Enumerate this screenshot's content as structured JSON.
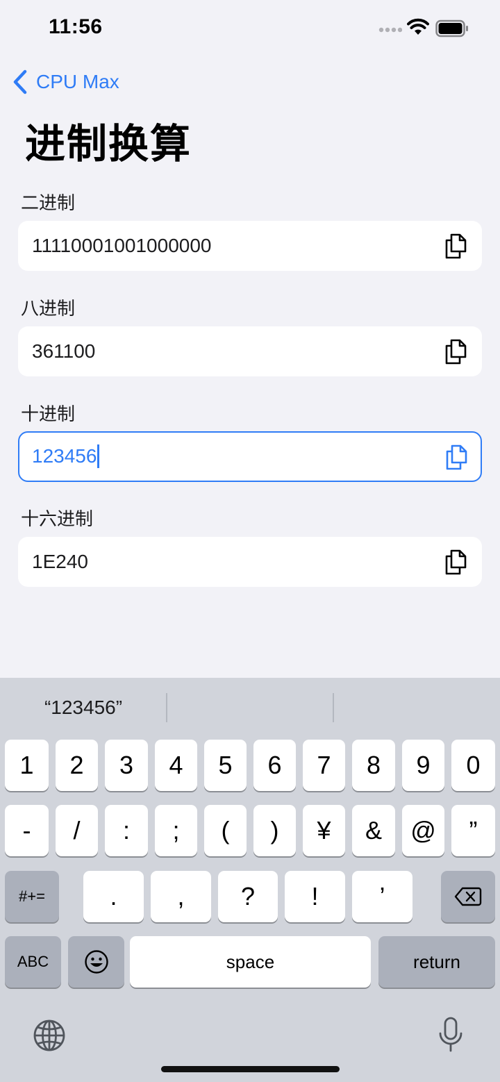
{
  "status_bar": {
    "time": "11:56"
  },
  "nav": {
    "back_label": "CPU Max",
    "title": "进制换算"
  },
  "fields": [
    {
      "label": "二进制",
      "value": "11110001001000000",
      "active": false
    },
    {
      "label": "八进制",
      "value": "361100",
      "active": false
    },
    {
      "label": "十进制",
      "value": "123456",
      "active": true
    },
    {
      "label": "十六进制",
      "value": "1E240",
      "active": false
    }
  ],
  "keyboard": {
    "suggestions": [
      "“123456”",
      "",
      ""
    ],
    "row1": [
      "1",
      "2",
      "3",
      "4",
      "5",
      "6",
      "7",
      "8",
      "9",
      "0"
    ],
    "row2": [
      "-",
      "/",
      ":",
      ";",
      "(",
      ")",
      "¥",
      "&",
      "@",
      "”"
    ],
    "row3_left": "#+=",
    "row3": [
      ".",
      ",",
      "?",
      "!",
      "’"
    ],
    "abc": "ABC",
    "space": "space",
    "return": "return"
  },
  "colors": {
    "accent": "#2f7cf6",
    "background": "#f2f2f7",
    "keyboard": "#d1d4db"
  }
}
